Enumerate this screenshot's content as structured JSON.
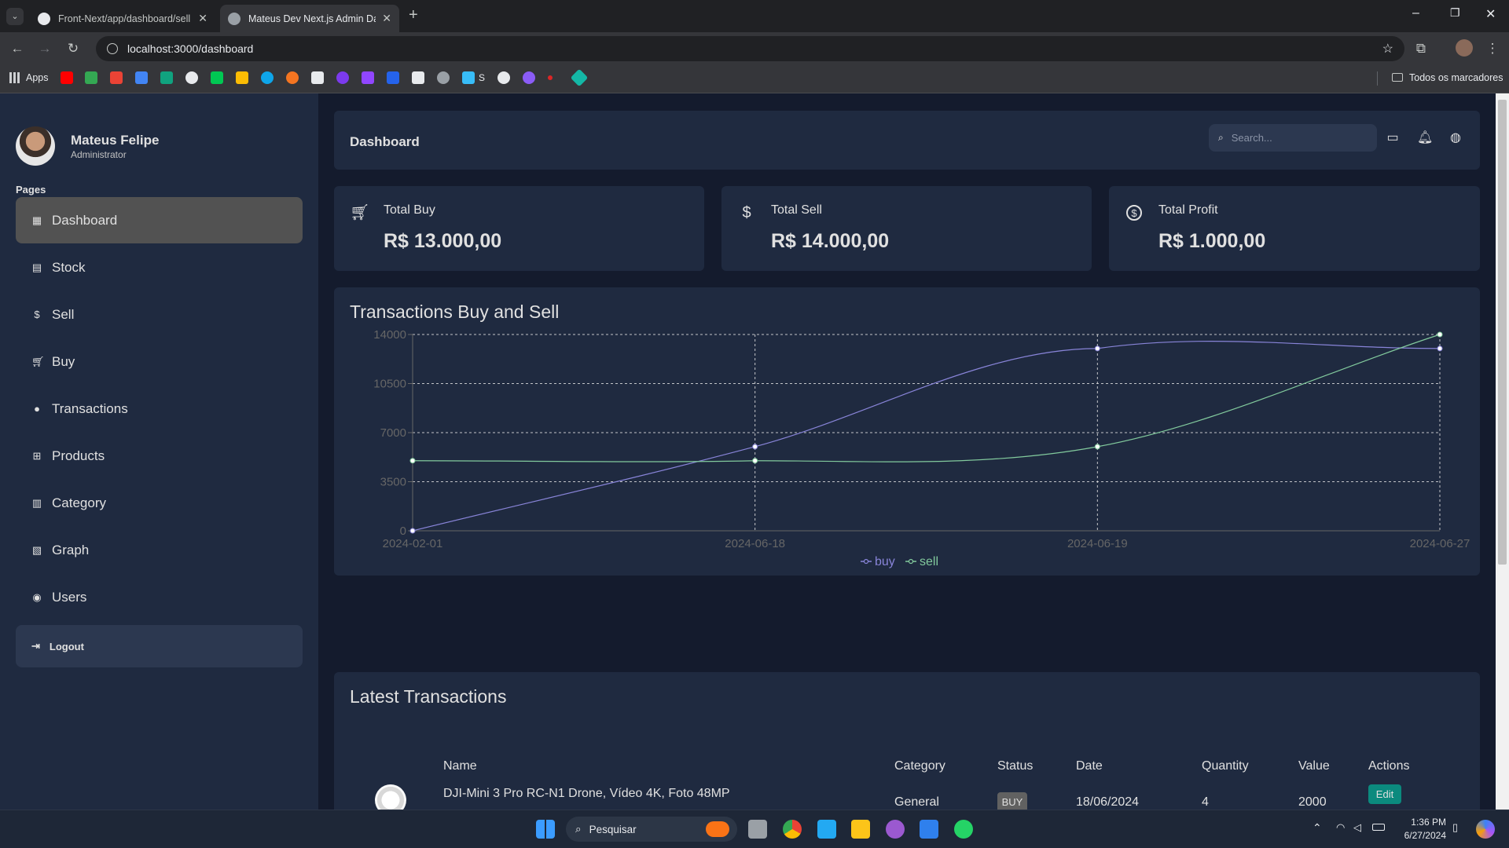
{
  "browser": {
    "tabs": [
      {
        "title": "Front-Next/app/dashboard/sell",
        "active": false
      },
      {
        "title": "Mateus Dev Next.js Admin Dash",
        "active": true
      }
    ],
    "url": "localhost:3000/dashboard",
    "bookmarks_apps": "Apps",
    "bookmarks_s": "S",
    "bookmarks_folder": "Todos os marcadores"
  },
  "sidebar": {
    "user_name": "Mateus Felipe",
    "user_role": "Administrator",
    "section_label": "Pages",
    "items": [
      {
        "label": "Dashboard",
        "icon": "dashboard-icon",
        "active": true
      },
      {
        "label": "Stock",
        "icon": "stock-icon"
      },
      {
        "label": "Sell",
        "icon": "sell-icon"
      },
      {
        "label": "Buy",
        "icon": "buy-icon"
      },
      {
        "label": "Transactions",
        "icon": "transactions-icon"
      },
      {
        "label": "Products",
        "icon": "products-icon"
      },
      {
        "label": "Category",
        "icon": "category-icon"
      },
      {
        "label": "Graph",
        "icon": "graph-icon"
      },
      {
        "label": "Users",
        "icon": "users-icon"
      }
    ],
    "logout_label": "Logout"
  },
  "header": {
    "title": "Dashboard",
    "search_placeholder": "Search..."
  },
  "stats": [
    {
      "title": "Total Buy",
      "value": "R$ 13.000,00",
      "icon": "cart-icon"
    },
    {
      "title": "Total Sell",
      "value": "R$ 14.000,00",
      "icon": "dollar-icon"
    },
    {
      "title": "Total Profit",
      "value": "R$ 1.000,00",
      "icon": "dollar-outline-icon"
    }
  ],
  "chart_section": {
    "title": "Transactions Buy and Sell"
  },
  "chart_data": {
    "type": "line",
    "title": "Transactions Buy and Sell",
    "categories": [
      "2024-02-01",
      "2024-06-18",
      "2024-06-19",
      "2024-06-27"
    ],
    "series": [
      {
        "name": "buy",
        "color": "#8884d8",
        "values": [
          0,
          6000,
          13000,
          13000
        ]
      },
      {
        "name": "sell",
        "color": "#82ca9d",
        "values": [
          5000,
          5000,
          6000,
          14000
        ]
      }
    ],
    "yticks": [
      "0",
      "3500",
      "7000",
      "10500",
      "14000"
    ],
    "ylim": [
      0,
      14000
    ],
    "grid": true,
    "legend": "bottom-center"
  },
  "latest": {
    "title": "Latest Transactions",
    "headers": [
      "Name",
      "Category",
      "Status",
      "Date",
      "Quantity",
      "Value",
      "Actions"
    ],
    "rows": [
      {
        "name": "DJI-Mini 3 Pro RC-N1 Drone, Vídeo 4K, Foto 48MP",
        "category": "General",
        "status": "BUY",
        "date": "18/06/2024",
        "quantity": "4",
        "value": "2000",
        "action": "Edit"
      }
    ]
  },
  "taskbar": {
    "search_label": "Pesquisar",
    "time": "1:36 PM",
    "date": "6/27/2024"
  }
}
